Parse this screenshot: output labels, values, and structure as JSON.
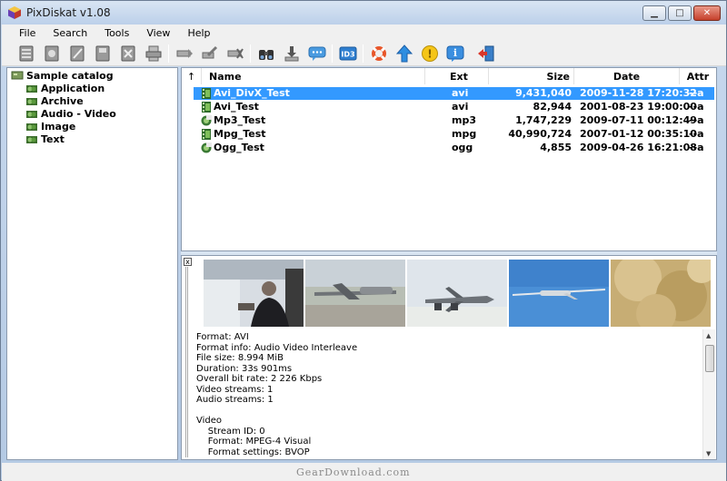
{
  "window": {
    "title": "PixDiskat v1.08",
    "icon": "app-cube-icon"
  },
  "menu": [
    "File",
    "Search",
    "Tools",
    "View",
    "Help"
  ],
  "toolbar": {
    "icons": [
      "catalog-new-icon",
      "catalog-open-icon",
      "catalog-edit-icon",
      "catalog-save-icon",
      "catalog-delete-icon",
      "catalog-print-icon",
      "item-add-icon",
      "item-edit-icon",
      "item-delete-icon",
      "search-binoculars-icon",
      "download-icon",
      "comment-icon",
      "id3-tag-icon",
      "help-lifebuoy-icon",
      "update-arrow-icon",
      "info-coin-icon",
      "about-info-icon",
      "exit-door-icon"
    ]
  },
  "tree": {
    "root": "Sample catalog",
    "children": [
      "Application",
      "Archive",
      "Audio - Video",
      "Image",
      "Text"
    ],
    "selected": "Audio - Video"
  },
  "file_list": {
    "sort_indicator": "↑",
    "columns": [
      "Name",
      "Ext",
      "Size",
      "Date",
      "Attr"
    ],
    "rows": [
      {
        "name": "Avi_DivX_Test",
        "ext": "avi",
        "size": "9,431,040",
        "date": "2009-11-28 17:20:32",
        "attr": "--a",
        "icon": "film-icon",
        "selected": true
      },
      {
        "name": "Avi_Test",
        "ext": "avi",
        "size": "82,944",
        "date": "2001-08-23 19:00:00",
        "attr": "--a",
        "icon": "film-icon",
        "selected": false
      },
      {
        "name": "Mp3_Test",
        "ext": "mp3",
        "size": "1,747,229",
        "date": "2009-07-11 00:12:49",
        "attr": "--a",
        "icon": "audio-icon",
        "selected": false
      },
      {
        "name": "Mpg_Test",
        "ext": "mpg",
        "size": "40,990,724",
        "date": "2007-01-12 00:35:10",
        "attr": "--a",
        "icon": "film-icon",
        "selected": false
      },
      {
        "name": "Ogg_Test",
        "ext": "ogg",
        "size": "4,855",
        "date": "2009-04-26 16:21:08",
        "attr": "--a",
        "icon": "audio-icon",
        "selected": false
      }
    ]
  },
  "preview": {
    "close_glyph": "x",
    "thumbnails": [
      "video-frame-person",
      "video-frame-plane-ground",
      "video-frame-jet",
      "video-frame-drone-sky",
      "video-frame-dust"
    ],
    "info_lines": [
      "Format: AVI",
      "Format info: Audio Video Interleave",
      "File size: 8.994 MiB",
      "Duration: 33s 901ms",
      "Overall bit rate: 2 226 Kbps",
      "Video streams: 1",
      "Audio streams: 1",
      "",
      "Video",
      "    Stream ID: 0",
      "    Format: MPEG-4 Visual",
      "    Format settings: BVOP"
    ]
  },
  "watermark": "GearDownload.com",
  "colors": {
    "selection": "#3399ff",
    "window_chrome": "#c8d9ee"
  }
}
